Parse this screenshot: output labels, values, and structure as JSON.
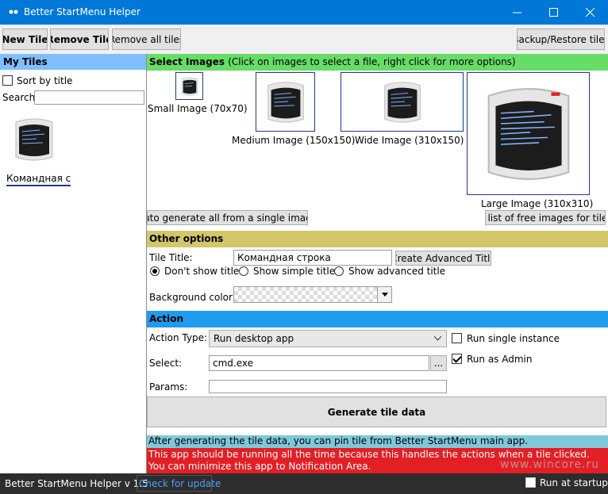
{
  "window": {
    "title": "Better StartMenu Helper"
  },
  "toolbar": {
    "new_tile": "New Tile",
    "remove_tile": "Remove Tile",
    "remove_all": "Remove all tiles",
    "backup": "Backup/Restore tiles"
  },
  "sidebar": {
    "header": "My Tiles",
    "sort_label": "Sort by title",
    "sort_checked": false,
    "search_label": "Search:",
    "search_value": "",
    "tiles": [
      {
        "label": "Командная с"
      }
    ]
  },
  "images": {
    "header": "Select Images",
    "hint": "(Click on images to select a file, right click for more options)",
    "small": "Small Image (70x70)",
    "medium": "Medium Image (150x150)",
    "wide": "Wide Image (310x150)",
    "large": "Large Image (310x310)",
    "auto_generate": "Auto generate all from a single image",
    "free_images": "A list of free images for tiles"
  },
  "other": {
    "header": "Other options",
    "tile_title_label": "Tile Title:",
    "tile_title_value": "Командная строка",
    "create_advanced": "Create Advanced Title",
    "radio_dont_show": "Don't show title",
    "radio_simple": "Show simple title",
    "radio_advanced": "Show advanced title",
    "selected_radio": "dont_show",
    "bg_color_label": "Background color:"
  },
  "action": {
    "header": "Action",
    "type_label": "Action Type:",
    "type_value": "Run desktop app",
    "select_label": "Select:",
    "select_value": "cmd.exe",
    "browse": "...",
    "params_label": "Params:",
    "params_value": "",
    "run_single": "Run single instance",
    "run_single_checked": false,
    "run_admin": "Run as Admin",
    "run_admin_checked": true,
    "generate": "Generate tile data"
  },
  "notices": {
    "info": "After generating the tile data, you can pin tile from Better StartMenu main app.",
    "warning": "This app should be running all the time because this handles the actions when a tile clicked. You can minimize this app to Notification Area."
  },
  "footer": {
    "version": "Better StartMenu Helper v 1.5",
    "check_update": "Check for update",
    "run_startup": "Run at startup",
    "run_startup_checked": false
  },
  "watermark": "www.wincore.ru",
  "colors": {
    "titlebar": "#0078d7",
    "images_header": "#66dd66",
    "other_header": "#d4c66a",
    "action_header": "#1e9cf0",
    "sidebar_header": "#7fbfff"
  }
}
